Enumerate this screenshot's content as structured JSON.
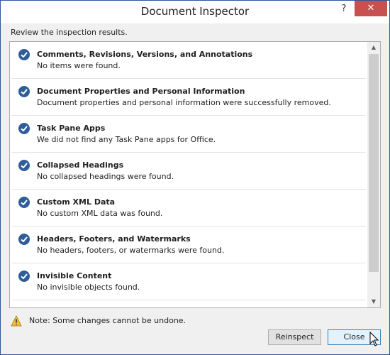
{
  "window": {
    "title": "Document Inspector",
    "help_label": "?",
    "close_label": "✕"
  },
  "review_label": "Review the inspection results.",
  "results": [
    {
      "title": "Comments, Revisions, Versions, and Annotations",
      "desc": "No items were found."
    },
    {
      "title": "Document Properties and Personal Information",
      "desc": "Document properties and personal information were successfully removed."
    },
    {
      "title": "Task Pane Apps",
      "desc": "We did not find any Task Pane apps for Office."
    },
    {
      "title": "Collapsed Headings",
      "desc": "No collapsed headings were found."
    },
    {
      "title": "Custom XML Data",
      "desc": "No custom XML data was found."
    },
    {
      "title": "Headers, Footers, and Watermarks",
      "desc": "No headers, footers, or watermarks were found."
    },
    {
      "title": "Invisible Content",
      "desc": "No invisible objects found."
    }
  ],
  "note": "Note: Some changes cannot be undone.",
  "buttons": {
    "reinspect_label": "Reinspect",
    "close_label": "Close"
  },
  "colors": {
    "check": "#2e5d9a",
    "close_button": "#c75050",
    "warning": "#f0c040"
  }
}
